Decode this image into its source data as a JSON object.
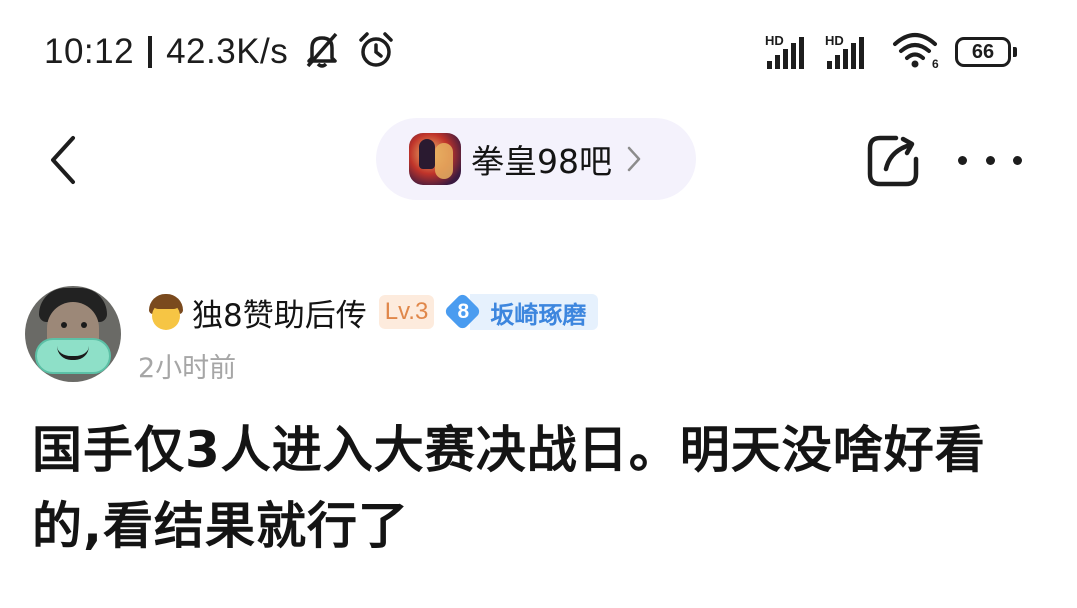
{
  "status_bar": {
    "time": "10:12",
    "net_speed": "42.3K/s",
    "signal_1_label": "HD",
    "signal_2_label": "HD",
    "battery": "66",
    "icons": [
      "mute-icon",
      "alarm-icon",
      "signal-icon",
      "wifi-icon",
      "battery-icon"
    ]
  },
  "nav": {
    "forum_name": "拳皇98吧",
    "icons": [
      "back-icon",
      "chevron-right-icon",
      "share-icon",
      "more-icon"
    ]
  },
  "post": {
    "author": "独8赞助后传",
    "level": "Lv.3",
    "fan_level": "8",
    "fan_title": "坂崎琢磨",
    "time": "2小时前",
    "title": "国手仅3人进入大赛决战日。明天没啥好看的,看结果就行了"
  },
  "colors": {
    "pill_bg": "#f4f2fc",
    "level_bg": "#fdebdd",
    "level_text": "#e0874a",
    "fan_accent": "#4a9cf0",
    "meta_text": "#a6a6a6"
  }
}
